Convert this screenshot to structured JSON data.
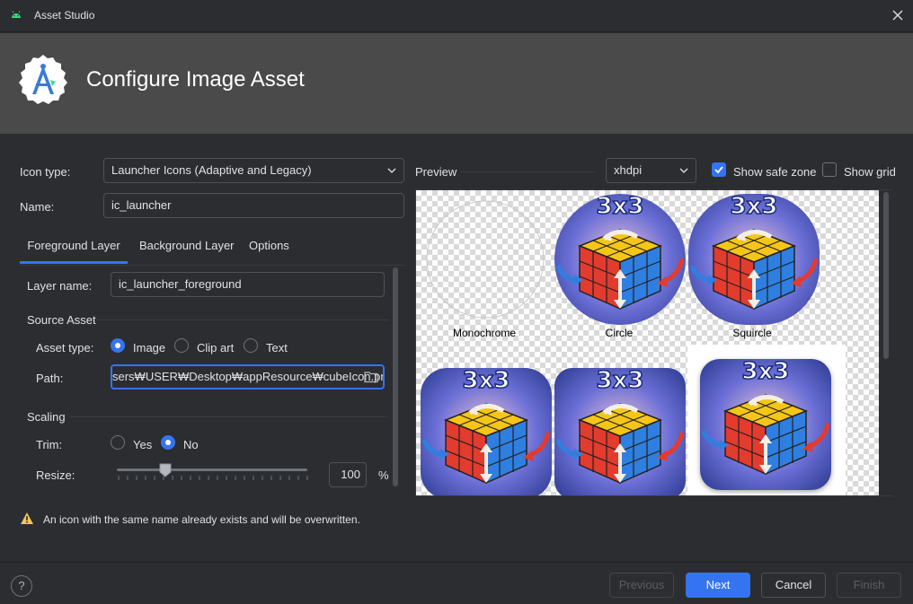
{
  "window": {
    "title": "Asset Studio"
  },
  "header": {
    "title": "Configure Image Asset"
  },
  "form": {
    "icon_type_label": "Icon type:",
    "icon_type_value": "Launcher Icons (Adaptive and Legacy)",
    "name_label": "Name:",
    "name_value": "ic_launcher"
  },
  "tabs": [
    {
      "label": "Foreground Layer",
      "active": true
    },
    {
      "label": "Background Layer",
      "active": false
    },
    {
      "label": "Options",
      "active": false
    }
  ],
  "foreground": {
    "layer_name_label": "Layer name:",
    "layer_name_value": "ic_launcher_foreground",
    "source_asset_title": "Source Asset",
    "asset_type_label": "Asset type:",
    "asset_types": [
      "Image",
      "Clip art",
      "Text"
    ],
    "asset_type_selected": "Image",
    "path_label": "Path:",
    "path_value": "sers₩USER₩Desktop₩appResource₩cubeIcon.png",
    "scaling_title": "Scaling",
    "trim_label": "Trim:",
    "trim_options": [
      "Yes",
      "No"
    ],
    "trim_selected": "No",
    "resize_label": "Resize:",
    "resize_value": "100",
    "resize_unit": "%",
    "resize_slider_fraction": 0.25
  },
  "preview": {
    "label": "Preview",
    "density": "xhdpi",
    "show_safe_zone_label": "Show safe zone",
    "show_safe_zone_checked": true,
    "show_grid_label": "Show grid",
    "show_grid_checked": false,
    "cells": [
      "Monochrome",
      "Circle",
      "Squircle"
    ]
  },
  "warning": {
    "text": "An icon with the same name already exists and will be overwritten."
  },
  "footer": {
    "help": "?",
    "previous": "Previous",
    "next": "Next",
    "cancel": "Cancel",
    "finish": "Finish"
  },
  "colors": {
    "accent": "#3574f0",
    "background": "#2b2d30",
    "banner": "#4a4a4a"
  }
}
